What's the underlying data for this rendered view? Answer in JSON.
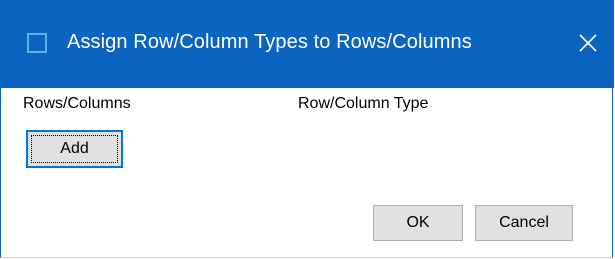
{
  "dialog": {
    "title": "Assign Row/Column Types to Rows/Columns",
    "close_glyph": "close-icon",
    "accent_color": "#0a64c0"
  },
  "labels": {
    "rows_columns": "Rows/Columns",
    "row_column_type": "Row/Column Type"
  },
  "buttons": {
    "add": "Add",
    "ok": "OK",
    "cancel": "Cancel"
  }
}
